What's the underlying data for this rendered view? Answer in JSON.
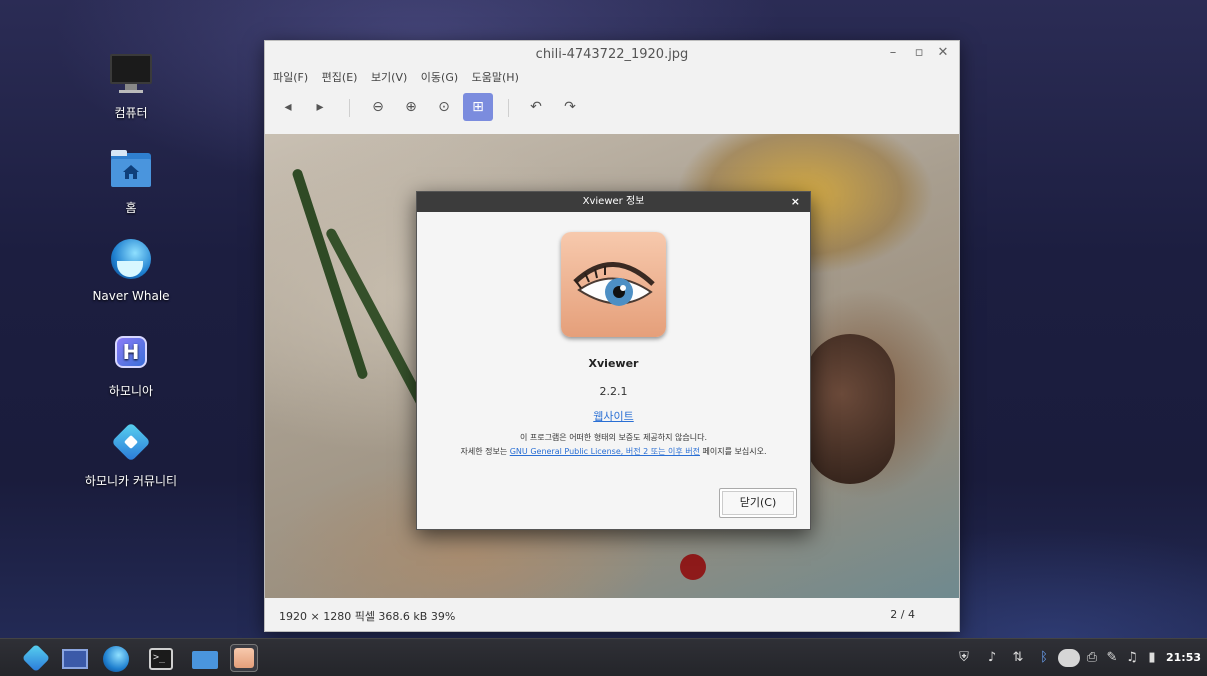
{
  "desktop": {
    "icons": [
      {
        "label": "컴퓨터",
        "icon": "computer-icon"
      },
      {
        "label": "홈",
        "icon": "home-folder-icon"
      },
      {
        "label": "Naver Whale",
        "icon": "whale-browser-icon"
      },
      {
        "label": "하모니아",
        "icon": "harmonia-icon"
      },
      {
        "label": "하모니카 커뮤니티",
        "icon": "hamonikr-community-icon"
      }
    ]
  },
  "window": {
    "title": "chili-4743722_1920.jpg",
    "controls": {
      "minimize": "–",
      "maximize": "▫",
      "close": "✕"
    },
    "menu": [
      "파일(F)",
      "편집(E)",
      "보기(V)",
      "이동(G)",
      "도움말(H)"
    ],
    "toolbar": {
      "back": "◂",
      "forward": "▸",
      "zoom_out": "⊖",
      "zoom_in": "⊕",
      "zoom_fit": "⊙",
      "fit_window": "⊞",
      "rotate_left": "↶",
      "rotate_right": "↷"
    },
    "status": {
      "info": "1920 × 1280 픽셀  368.6 kB   39%",
      "position": "2 / 4"
    }
  },
  "about_dialog": {
    "title": "Xviewer 정보",
    "close": "×",
    "app_name": "Xviewer",
    "version": "2.2.1",
    "website": "웹사이트",
    "warranty": "이 프로그램은 어떠한 형태의 보증도 제공하지 않습니다.",
    "license_prefix": "자세한 정보는 ",
    "license_link": "GNU General Public License, 버전 2 또는 이후 버전",
    "license_suffix": " 페이지를 보십시오.",
    "close_button": "닫기(C)"
  },
  "taskbar": {
    "apps": [
      "hamonikr-menu-icon",
      "show-desktop-icon",
      "whale-browser-icon",
      "terminal-icon",
      "file-manager-icon",
      "xviewer-icon"
    ],
    "tray": [
      "shield-icon",
      "music-icon",
      "network-icon",
      "bluetooth-icon",
      "toggle-icon",
      "printer-icon",
      "pen-icon",
      "volume-icon",
      "battery-icon"
    ],
    "clock": "21:53"
  },
  "colors": {
    "accent": "#7b8cde",
    "link": "#2a6fd4",
    "dialog_title": "#3c3c3c"
  }
}
